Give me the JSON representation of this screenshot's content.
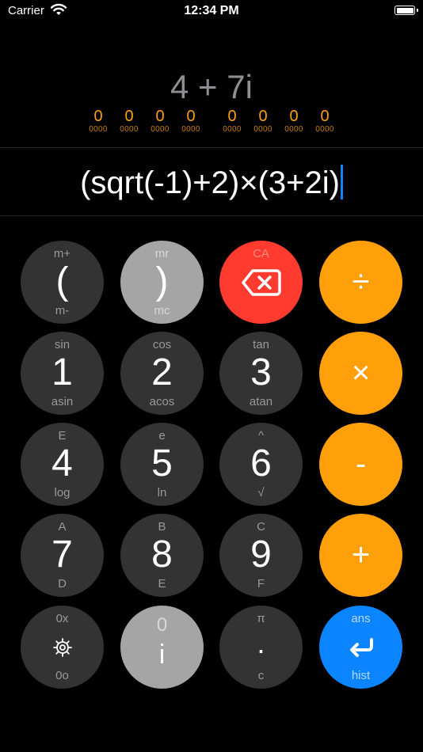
{
  "status": {
    "carrier": "Carrier",
    "time": "12:34 PM"
  },
  "display": {
    "result": "4 + 7i",
    "expression": "(sqrt(-1)+2)×(3+2i)",
    "bits": [
      {
        "digit": "0",
        "binary": "0000"
      },
      {
        "digit": "0",
        "binary": "0000"
      },
      {
        "digit": "0",
        "binary": "0000"
      },
      {
        "digit": "0",
        "binary": "0000"
      },
      {
        "digit": "0",
        "binary": "0000"
      },
      {
        "digit": "0",
        "binary": "0000"
      },
      {
        "digit": "0",
        "binary": "0000"
      },
      {
        "digit": "0",
        "binary": "0000"
      }
    ]
  },
  "keys": {
    "open_paren": {
      "top": "m+",
      "main": "(",
      "bottom": "m-"
    },
    "close_paren": {
      "top": "mr",
      "main": ")",
      "bottom": "mc"
    },
    "backspace": {
      "top": "CA",
      "icon": "backspace-icon"
    },
    "divide": {
      "main": "÷"
    },
    "one": {
      "top": "sin",
      "main": "1",
      "bottom": "asin"
    },
    "two": {
      "top": "cos",
      "main": "2",
      "bottom": "acos"
    },
    "three": {
      "top": "tan",
      "main": "3",
      "bottom": "atan"
    },
    "multiply": {
      "main": "×"
    },
    "four": {
      "top": "E",
      "main": "4",
      "bottom": "log"
    },
    "five": {
      "top": "e",
      "main": "5",
      "bottom": "ln"
    },
    "six": {
      "top": "^",
      "main": "6",
      "bottom": "√"
    },
    "minus": {
      "main": "-"
    },
    "seven": {
      "top": "A",
      "main": "7",
      "bottom": "D"
    },
    "eight": {
      "top": "B",
      "main": "8",
      "bottom": "E"
    },
    "nine": {
      "top": "C",
      "main": "9",
      "bottom": "F"
    },
    "plus": {
      "main": "+"
    },
    "settings": {
      "top": "0x",
      "icon": "gear-icon",
      "bottom": "0o"
    },
    "imag": {
      "top": "0",
      "main": "i"
    },
    "dot": {
      "top": "π",
      "main": "·",
      "bottom": "c"
    },
    "enter": {
      "top": "ans",
      "icon": "return-icon",
      "bottom": "hist"
    }
  },
  "colors": {
    "accent_orange": "#ff9f0a",
    "danger_red": "#ff3b30",
    "enter_blue": "#0a84ff",
    "key_dark": "#333333",
    "key_light": "#a5a5a5"
  }
}
